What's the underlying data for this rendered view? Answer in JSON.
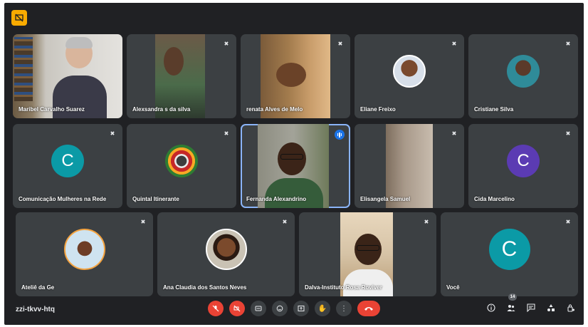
{
  "meeting": {
    "code": "zzi-tkvv-htq",
    "participant_count": "14"
  },
  "participants": [
    {
      "name": "Maribel Carvalho Suarez"
    },
    {
      "name": "Alexsandra s da silva"
    },
    {
      "name": "renata Alves de Melo"
    },
    {
      "name": "Eliane Freixo"
    },
    {
      "name": "Cristiane Silva"
    },
    {
      "name": "Comunicação Mulheres na Rede",
      "initial": "C"
    },
    {
      "name": "Quintal Itinerante"
    },
    {
      "name": "Fernanda Alexandrino"
    },
    {
      "name": "Elisangela Samuel"
    },
    {
      "name": "Cida Marcelino",
      "initial": "C"
    },
    {
      "name": "Ateliê da Ge"
    },
    {
      "name": "Ana Claudia dos Santos Neves"
    },
    {
      "name": "Dalva-Instituto Rosa Roviver"
    },
    {
      "name": "Você",
      "initial": "C"
    }
  ],
  "colors": {
    "background": "#202124",
    "tile": "#3c4043",
    "active_border": "#8ab4f8",
    "teal_avatar": "#0b9aa6",
    "purple_avatar": "#5b3bb3",
    "hangup": "#ea4335"
  },
  "icons": {
    "badge": "screen-share-off-icon",
    "mute": "mic-off-icon",
    "controls": [
      "mic-off-icon",
      "camera-off-icon",
      "captions-icon",
      "emoji-icon",
      "present-icon",
      "raise-hand-icon",
      "more-options-icon",
      "hangup-icon"
    ],
    "right": [
      "info-icon",
      "people-icon",
      "chat-icon",
      "activities-icon",
      "host-controls-icon"
    ]
  }
}
